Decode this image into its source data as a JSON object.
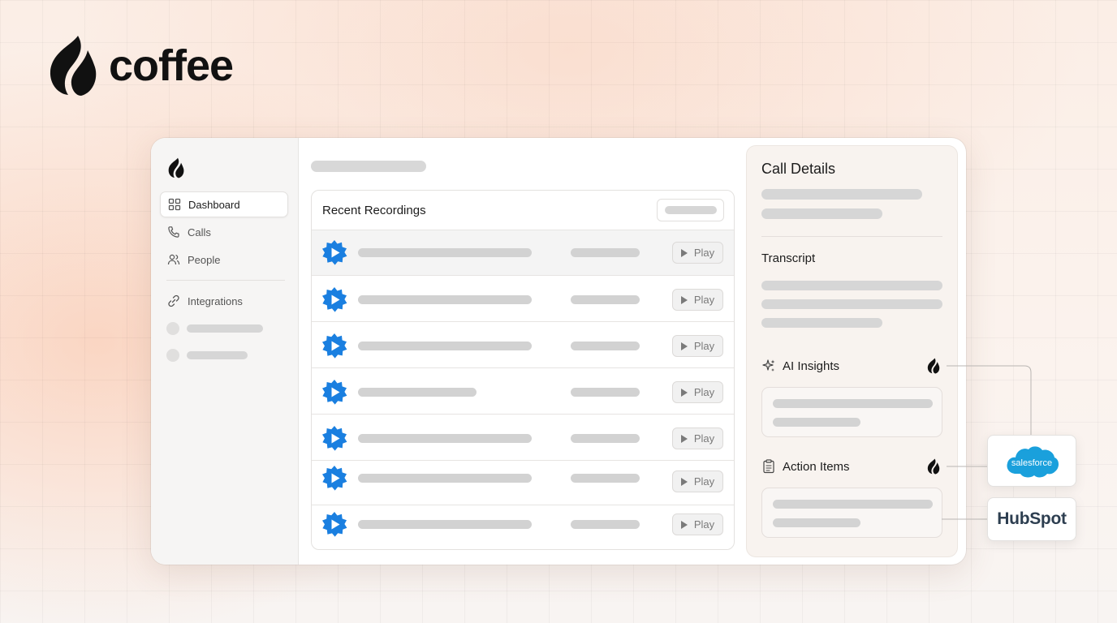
{
  "brand": {
    "name": "coffee"
  },
  "sidebar": {
    "items": [
      {
        "label": "Dashboard",
        "icon": "dashboard-grid-icon",
        "active": true
      },
      {
        "label": "Calls",
        "icon": "phone-icon",
        "active": false
      },
      {
        "label": "People",
        "icon": "people-icon",
        "active": false
      },
      {
        "label": "Integrations",
        "icon": "link-icon",
        "active": false
      }
    ]
  },
  "recordings": {
    "title": "Recent Recordings",
    "play_label": "Play",
    "rows": [
      {
        "highlighted": true
      },
      {
        "highlighted": false
      },
      {
        "highlighted": false
      },
      {
        "highlighted": false
      },
      {
        "highlighted": false
      },
      {
        "highlighted": false
      },
      {
        "highlighted": false
      }
    ]
  },
  "details": {
    "title": "Call Details",
    "transcript": "Transcript",
    "ai_insights": "AI Insights",
    "action_items": "Action Items"
  },
  "integrations": {
    "salesforce": "salesforce",
    "hubspot": "HubSpot"
  },
  "colors": {
    "accent_blue": "#1a7fe0",
    "salesforce_blue": "#1aa0dc",
    "hubspot_orange": "#f57722"
  }
}
